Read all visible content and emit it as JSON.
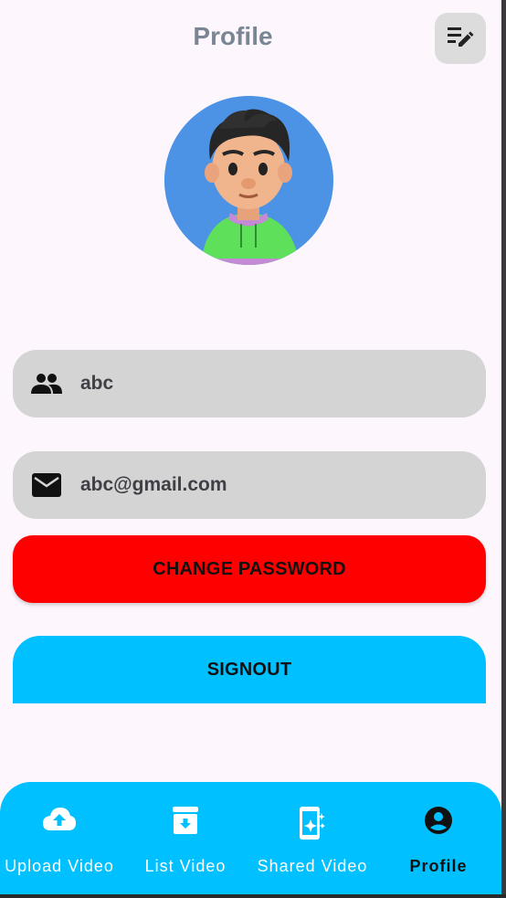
{
  "header": {
    "title": "Profile"
  },
  "profile": {
    "username": "abc",
    "email": "abc@gmail.com"
  },
  "buttons": {
    "change_password": "CHANGE PASSWORD",
    "signout": "SIGNOUT"
  },
  "nav": {
    "items": [
      {
        "label": "Upload Video",
        "icon": "cloud-upload-icon",
        "active": false
      },
      {
        "label": "List Video",
        "icon": "archive-icon",
        "active": false
      },
      {
        "label": "Shared Video",
        "icon": "phone-sparkle-icon",
        "active": false
      },
      {
        "label": "Profile",
        "icon": "account-circle-icon",
        "active": true
      }
    ]
  },
  "colors": {
    "background": "#fdf6fd",
    "field": "#d4d4d4",
    "change_password": "#ff0000",
    "signout": "#00c0ff",
    "navbar": "#00c0ff"
  }
}
